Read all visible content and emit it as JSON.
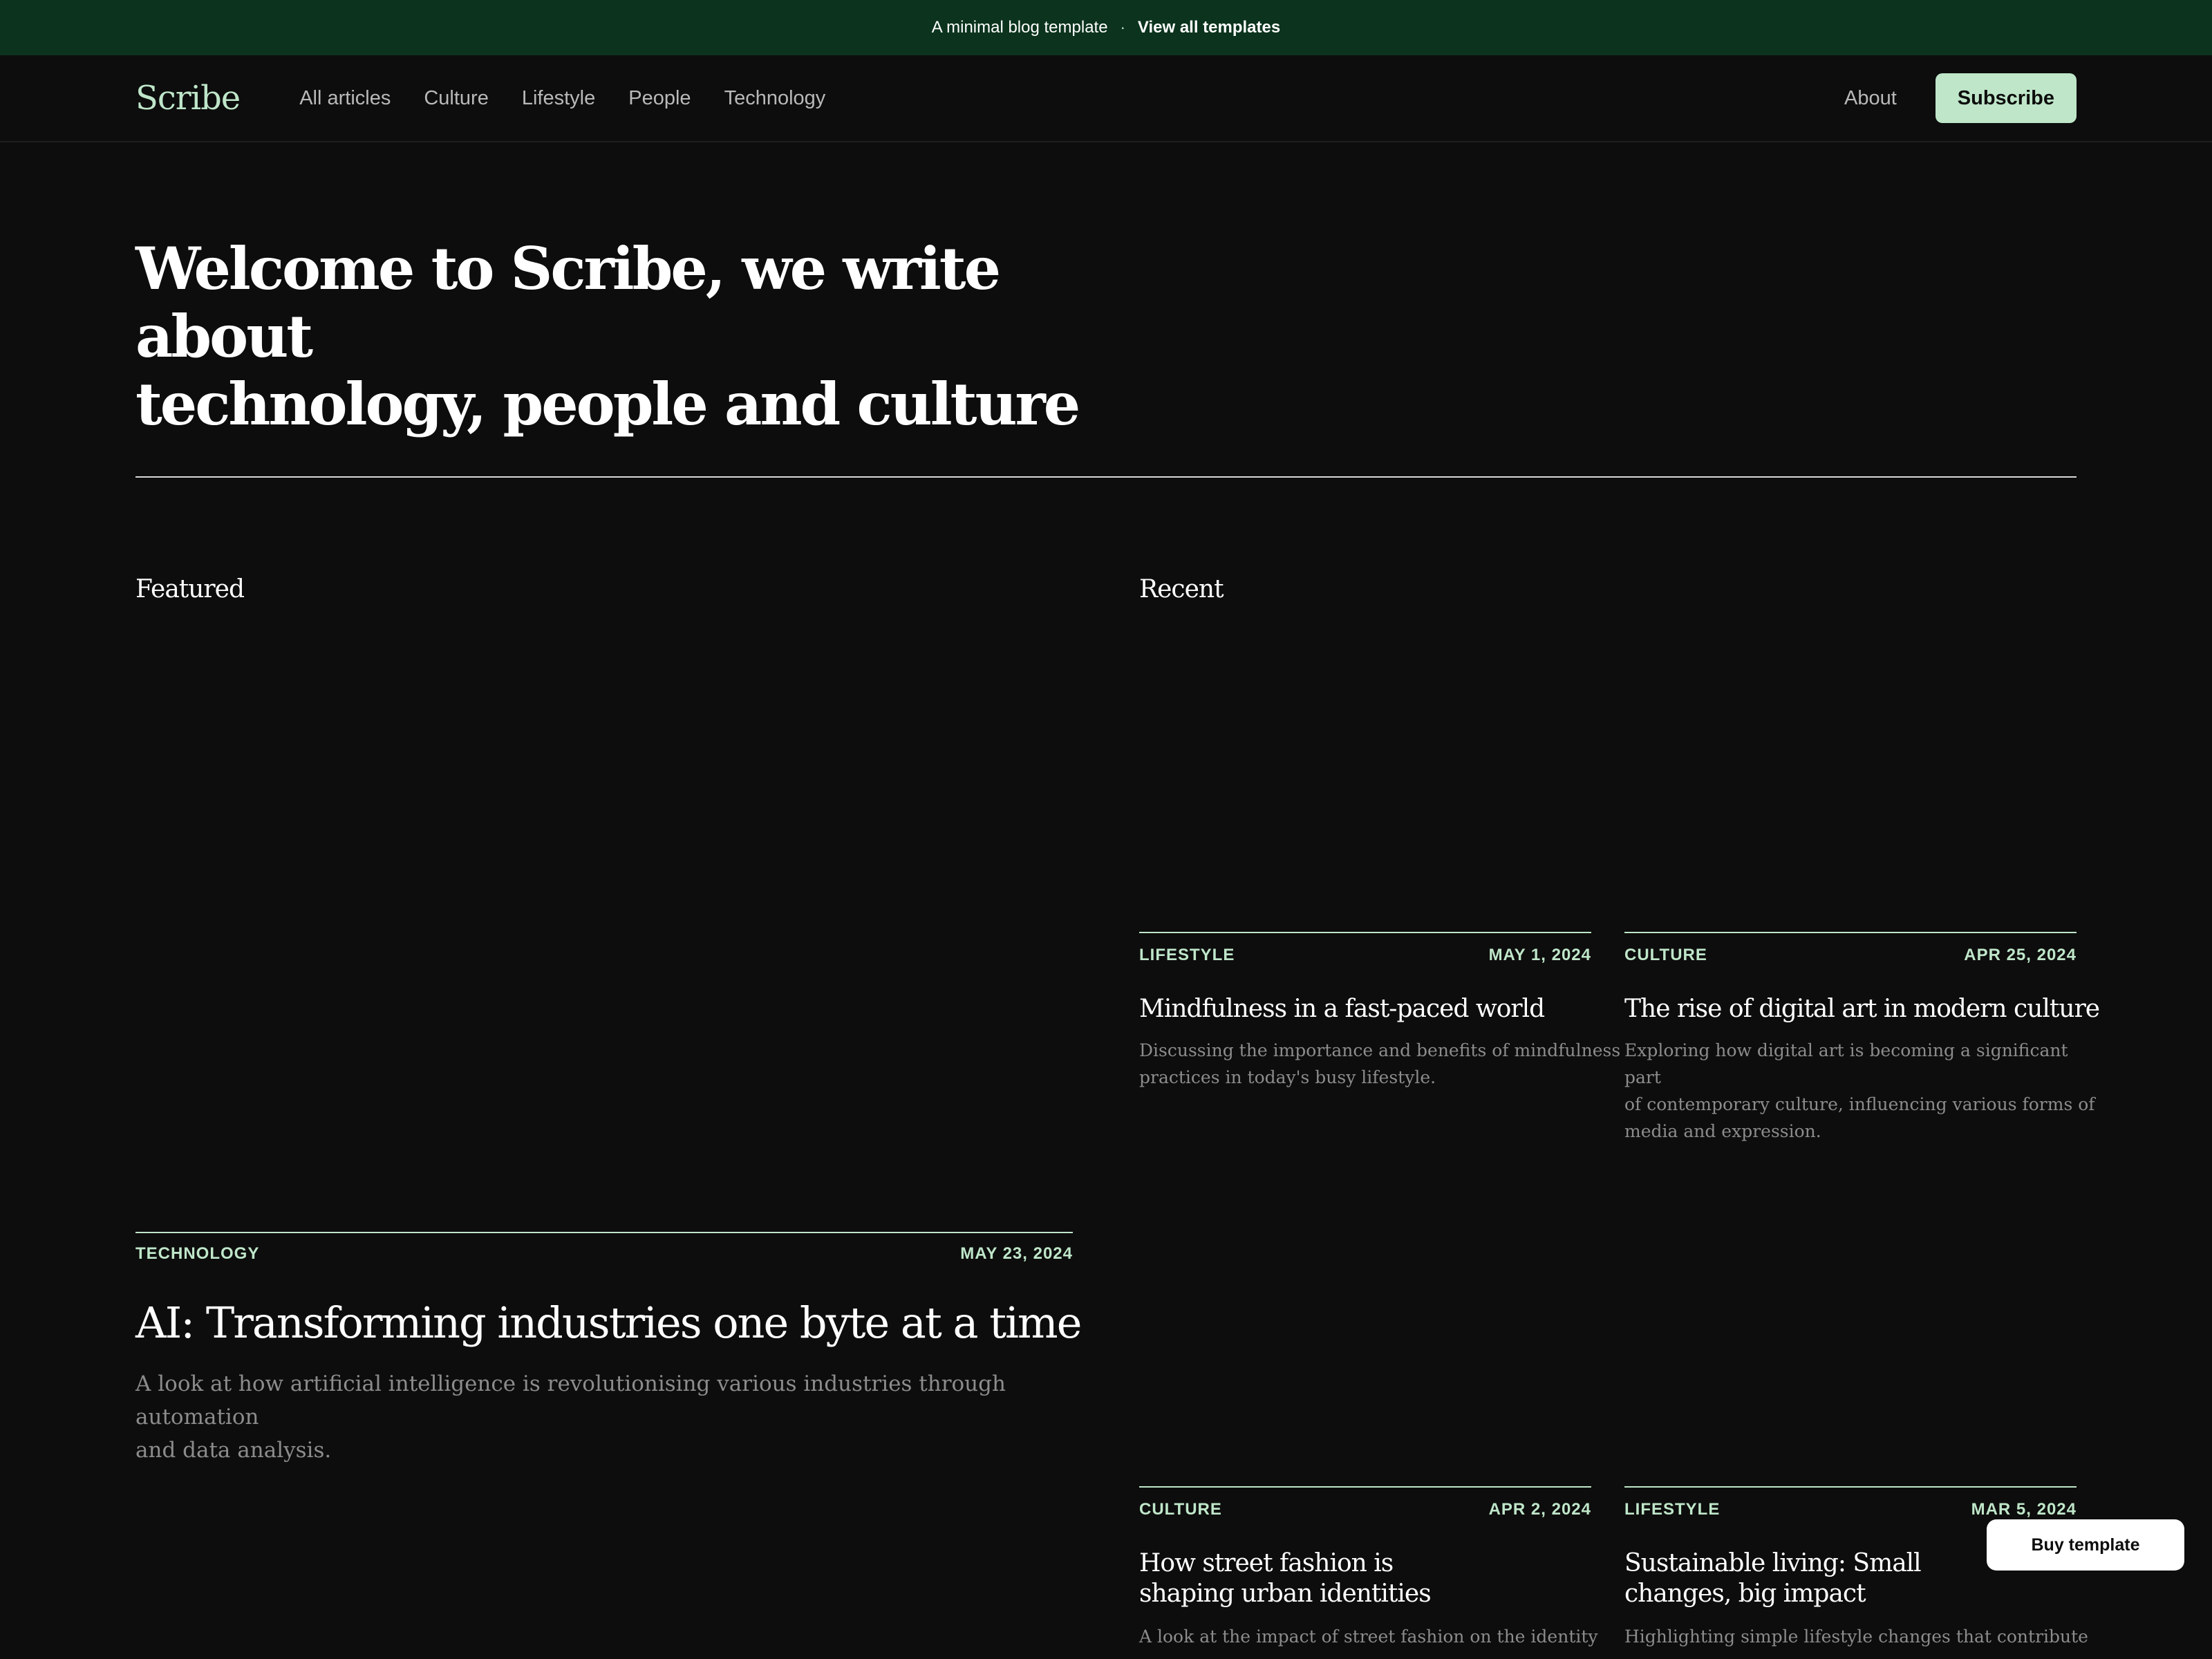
{
  "promo": {
    "text": "A minimal blog template",
    "separator": "·",
    "link": "View all templates"
  },
  "nav": {
    "logo": "Scribe",
    "links": [
      "All articles",
      "Culture",
      "Lifestyle",
      "People",
      "Technology"
    ],
    "about": "About",
    "subscribe": "Subscribe"
  },
  "hero": {
    "line1": "Welcome to Scribe, we write about",
    "line2": "technology, people and culture"
  },
  "featured": {
    "heading": "Featured",
    "article": {
      "category": "TECHNOLOGY",
      "date": "MAY 23, 2024",
      "title": "AI: Transforming industries one byte at a time",
      "desc_line1": "A look at how artificial intelligence is revolutionising various industries through automation",
      "desc_line2": "and data analysis."
    }
  },
  "recent": {
    "heading": "Recent",
    "articles": [
      {
        "category": "LIFESTYLE",
        "date": "MAY 1, 2024",
        "title_line1": "Mindfulness in a fast-paced world",
        "title_line2": "",
        "desc_line1": "Discussing the importance and benefits of mindfulness",
        "desc_line2": "practices in today's busy lifestyle.",
        "desc_line3": ""
      },
      {
        "category": "CULTURE",
        "date": "APR 25, 2024",
        "title_line1": "The rise of digital art in modern culture",
        "title_line2": "",
        "desc_line1": "Exploring how digital art is becoming a significant part",
        "desc_line2": "of contemporary culture, influencing various forms of",
        "desc_line3": "media and expression."
      },
      {
        "category": "CULTURE",
        "date": "APR 2, 2024",
        "title_line1": "How street fashion is",
        "title_line2": "shaping urban identities",
        "desc_line1": "A look at the impact of street fashion on the identity",
        "desc_line2": "",
        "desc_line3": ""
      },
      {
        "category": "LIFESTYLE",
        "date": "MAR 5, 2024",
        "title_line1": "Sustainable living: Small",
        "title_line2": "changes, big impact",
        "desc_line1": "Highlighting simple lifestyle changes that contribute",
        "desc_line2": "",
        "desc_line3": ""
      }
    ]
  },
  "buy_template": "Buy template",
  "colors": {
    "accent": "#bfe6c9",
    "promo_bg": "#0b331d",
    "page_bg": "#0d0d0d"
  }
}
